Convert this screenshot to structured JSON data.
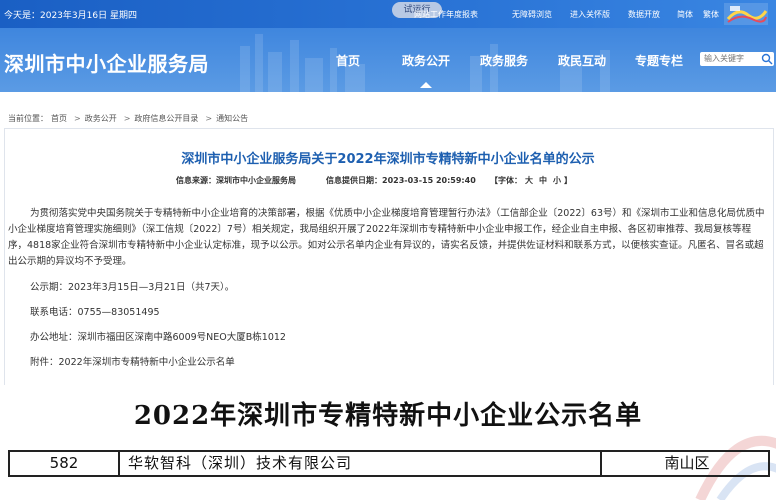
{
  "topbar": {
    "date": "今天是：2023年3月16日 星期四",
    "trial_badge": "试运行",
    "links": [
      "网站工作年度报表",
      "无障碍浏览",
      "进入关怀版",
      "数据开放",
      "简体",
      "繁体"
    ]
  },
  "header": {
    "site_title": "深圳市中小企业服务局",
    "nav": [
      "首页",
      "政务公开",
      "政务服务",
      "政民互动",
      "专题专栏"
    ],
    "active_nav": "政务公开",
    "search_placeholder": "输入关键字"
  },
  "breadcrumb": {
    "prefix": "当前位置：",
    "items": [
      "首页",
      "政务公开",
      "政府信息公开目录",
      "通知公告"
    ],
    "separator": ">"
  },
  "article": {
    "title": "深圳市中小企业服务局关于2022年深圳市专精特新中小企业名单的公示",
    "source_label": "信息来源：",
    "source_value": "深圳市中小企业服务局",
    "date_label": "信息提供日期：",
    "date_value": "2023-03-15 20:59:40",
    "font_label": "【字体：",
    "font_sizes": [
      "大",
      "中",
      "小"
    ],
    "font_label_end": "】",
    "paragraph": "为贯彻落实党中央国务院关于专精特新中小企业培育的决策部署，根据《优质中小企业梯度培育管理暂行办法》（工信部企业〔2022〕63号）和《深圳市工业和信息化局优质中小企业梯度培育管理实施细则》（深工信规〔2022〕7号）相关规定，我局组织开展了2022年深圳市专精特新中小企业申报工作，经企业自主申报、各区初审推荐、我局复核等程序，4818家企业符合深圳市专精特新中小企业认定标准，现予以公示。如对公示名单内企业有异议的，请实名反馈，并提供佐证材料和联系方式，以便核实查证。凡匿名、冒名或超出公示期的异议均不予受理。",
    "period": "公示期：2023年3月15日—3月21日（共7天）。",
    "phone": "联系电话：0755—83051495",
    "address": "办公地址：深圳市福田区深南中路6009号NEO大厦B栋1012",
    "attachment_label": "附件：",
    "attachment_link": "2022年深圳市专精特新中小企业公示名单"
  },
  "doc_image": {
    "heading": "2022年深圳市专精特新中小企业公示名单",
    "row": {
      "num": "582",
      "name": "华软智科（深圳）技术有限公司",
      "district": "南山区"
    }
  },
  "colors": {
    "brand_blue": "#2a74d6",
    "title_blue": "#1d5fb0"
  }
}
